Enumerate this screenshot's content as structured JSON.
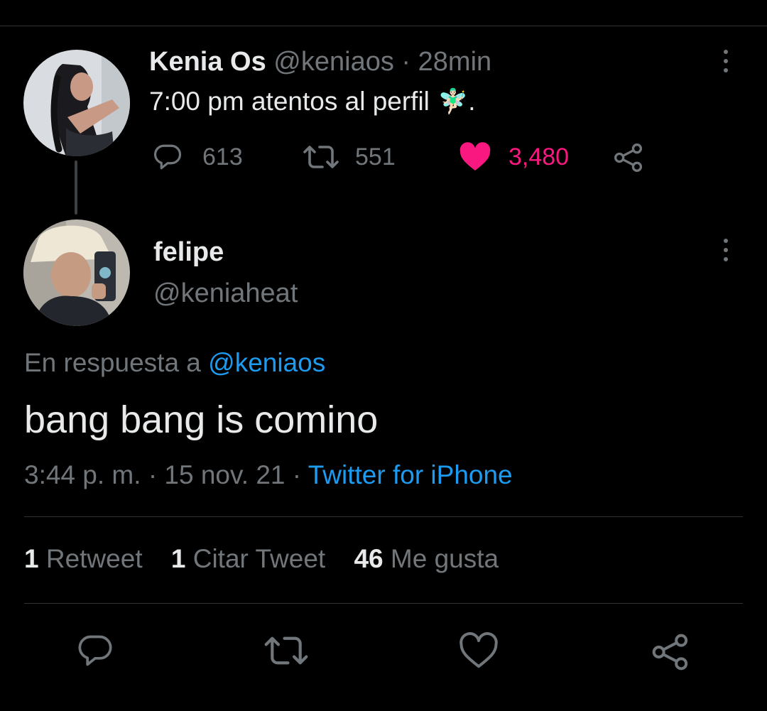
{
  "quoted_tweet": {
    "name": "Kenia Os",
    "handle": "@keniaos",
    "time": "28min",
    "text": "7:00 pm atentos al perfil",
    "emoji": "🧚🏻‍♂️",
    "text_end": ".",
    "reply_count": "613",
    "retweet_count": "551",
    "like_count": "3,480",
    "liked": true,
    "like_color": "#f91880"
  },
  "tweet": {
    "name": "felipe",
    "handle": "@keniaheat",
    "reply_prefix": "En respuesta a",
    "reply_to": "@keniaos",
    "text": "bang bang is comino",
    "time": "3:44 p. m.",
    "date": "15 nov. 21",
    "source": "Twitter for iPhone",
    "retweets": "1",
    "retweets_label": "Retweet",
    "quotes": "1",
    "quotes_label": "Citar Tweet",
    "likes": "46",
    "likes_label": "Me gusta"
  },
  "colors": {
    "background": "#000000",
    "text": "#e7e9ea",
    "muted": "#71767b",
    "link": "#1d9bf0",
    "like": "#f91880"
  },
  "icons": [
    "reply-icon",
    "retweet-icon",
    "like-icon",
    "share-icon",
    "more-icon"
  ]
}
